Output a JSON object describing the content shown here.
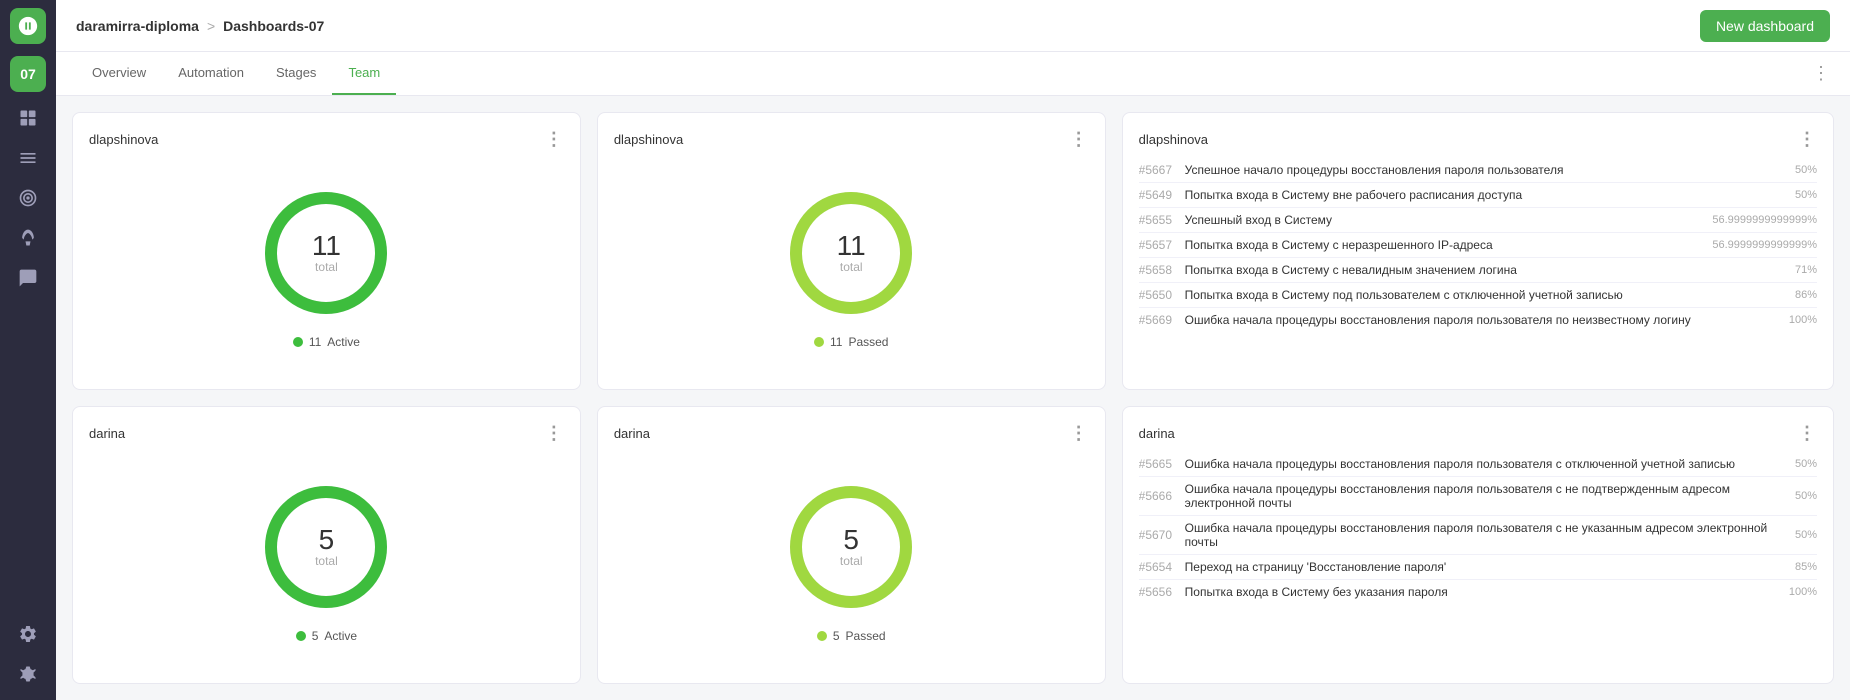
{
  "header": {
    "project": "daramirra-diploma",
    "separator": ">",
    "page": "Dashboards-07",
    "new_dashboard_label": "New dashboard"
  },
  "tabs": {
    "items": [
      {
        "label": "Overview",
        "active": false
      },
      {
        "label": "Automation",
        "active": false
      },
      {
        "label": "Stages",
        "active": false
      },
      {
        "label": "Team",
        "active": true
      }
    ],
    "more_icon": "⋮"
  },
  "cards": {
    "top_left": {
      "title": "dlapshinova",
      "value": "11",
      "label": "total",
      "legend_count": "11",
      "legend_text": "Active",
      "stroke_color": "#3dbd3d",
      "stroke_pct": 100
    },
    "top_mid": {
      "title": "dlapshinova",
      "value": "11",
      "label": "total",
      "legend_count": "11",
      "legend_text": "Passed",
      "stroke_color": "#a0d840",
      "stroke_pct": 100
    },
    "top_right": {
      "title": "dlapshinova",
      "rows": [
        {
          "id": "#5667",
          "text": "Успешное начало процедуры восстановления пароля пользователя",
          "pct": "50%",
          "bar": 50
        },
        {
          "id": "#5649",
          "text": "Попытка входа в Систему вне рабочего расписания доступа",
          "pct": "50%",
          "bar": 50
        },
        {
          "id": "#5655",
          "text": "Успешный вход в Систему",
          "pct": "56.9999999999999%",
          "bar": 57
        },
        {
          "id": "#5657",
          "text": "Попытка входа в Систему с неразрешенного IP-адреса",
          "pct": "56.9999999999999%",
          "bar": 57
        },
        {
          "id": "#5658",
          "text": "Попытка входа в Систему с невалидным значением логина",
          "pct": "71%",
          "bar": 71
        },
        {
          "id": "#5650",
          "text": "Попытка входа в Систему под пользователем с отключенной учетной записью",
          "pct": "86%",
          "bar": 86
        },
        {
          "id": "#5669",
          "text": "Ошибка начала процедуры восстановления пароля пользователя по неизвестному логину",
          "pct": "100%",
          "bar": 100
        }
      ]
    },
    "bot_left": {
      "title": "darina",
      "value": "5",
      "label": "total",
      "legend_count": "5",
      "legend_text": "Active",
      "stroke_color": "#3dbd3d",
      "stroke_pct": 100
    },
    "bot_mid": {
      "title": "darina",
      "value": "5",
      "label": "total",
      "legend_count": "5",
      "legend_text": "Passed",
      "stroke_color": "#a0d840",
      "stroke_pct": 100
    },
    "bot_right": {
      "title": "darina",
      "rows": [
        {
          "id": "#5665",
          "text": "Ошибка начала процедуры восстановления пароля пользователя с отключенной учетной записью",
          "pct": "50%",
          "bar": 50
        },
        {
          "id": "#5666",
          "text": "Ошибка начала процедуры восстановления пароля пользователя с не подтвержденным адресом электронной почты",
          "pct": "50%",
          "bar": 50
        },
        {
          "id": "#5670",
          "text": "Ошибка начала процедуры восстановления пароля пользователя с не указанным адресом электронной почты",
          "pct": "50%",
          "bar": 50
        },
        {
          "id": "#5654",
          "text": "Переход на страницу 'Восстановление пароля'",
          "pct": "85%",
          "bar": 85
        },
        {
          "id": "#5656",
          "text": "Попытка входа в Систему без указания пароля",
          "pct": "100%",
          "bar": 100
        }
      ]
    }
  },
  "sidebar": {
    "badge": "07"
  }
}
